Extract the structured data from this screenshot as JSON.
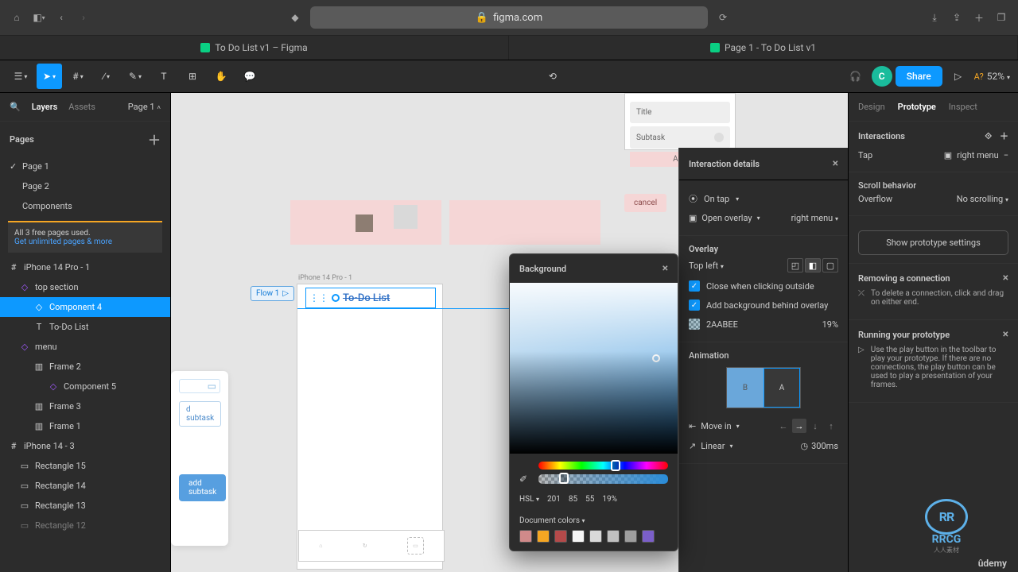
{
  "browser": {
    "url_host": "figma.com",
    "tab1": "To Do List v1 – Figma",
    "tab2": "Page 1 - To Do List v1"
  },
  "toolbar": {
    "share": "Share",
    "a2": "A?",
    "zoom": "52%",
    "avatar": "C"
  },
  "leftTabs": {
    "layers": "Layers",
    "assets": "Assets",
    "pageSel": "Page 1"
  },
  "pages": {
    "hdr": "Pages",
    "p1": "Page 1",
    "p2": "Page 2",
    "p3": "Components"
  },
  "banner": {
    "line1": "All 3 free pages used.",
    "line2": "Get unlimited pages & more"
  },
  "layers": {
    "f1": "iPhone 14 Pro - 1",
    "l1": "top section",
    "l2": "Component 4",
    "l3": "To-Do List",
    "l4": "menu",
    "l5": "Frame 2",
    "l6": "Component 5",
    "l7": "Frame 3",
    "l8": "Frame 1",
    "f2": "iPhone 14 - 3",
    "r1": "Rectangle 15",
    "r2": "Rectangle 14",
    "r3": "Rectangle 13",
    "r4": "Rectangle 12"
  },
  "canvas": {
    "frameLabel": "iPhone 14 Pro - 1",
    "flow": "Flow 1",
    "todo": "To-Do List",
    "title": "Title",
    "subtask": "Subtask",
    "add": "Add",
    "cancel": "cancel",
    "addsub1": "d subtask",
    "addsub2": "add subtask"
  },
  "bg": {
    "hdr": "Background",
    "mode": "HSL",
    "h": "201",
    "s": "85",
    "l": "55",
    "a": "19%",
    "doc": "Document colors",
    "swatches": [
      "#d08a8a",
      "#f5a623",
      "#b44a4a",
      "#f5f5f5",
      "#d9d9d9",
      "#c0c0c0",
      "#9e9e9e",
      "#7b5fc9"
    ]
  },
  "inter": {
    "hdr": "Interaction details",
    "trigger": "On tap",
    "action": "Open overlay",
    "target": "right menu",
    "overlay": "Overlay",
    "pos": "Top left",
    "chk1": "Close when clicking outside",
    "chk2": "Add background behind overlay",
    "hex": "2AABEE",
    "opacity": "19%",
    "anim": "Animation",
    "b": "B",
    "a2": "A",
    "move": "Move in",
    "ease": "Linear",
    "dur": "300ms"
  },
  "rr": {
    "design": "Design",
    "proto": "Prototype",
    "inspect": "Inspect",
    "interactions": "Interactions",
    "tap": "Tap",
    "target": "right menu",
    "scroll": "Scroll behavior",
    "overflow": "Overflow",
    "noscroll": "No scrolling",
    "showSettings": "Show prototype settings",
    "removing": "Removing a connection",
    "removingTxt": "To delete a connection, click and drag on either end.",
    "running": "Running your prototype",
    "runningTxt": "Use the play button in the toolbar to play your prototype. If there are no connections, the play button can be used to play a presentation of your frames."
  },
  "logo": {
    "rr": "RR",
    "rrcg": "RRCG",
    "sub": "人人素材",
    "udemy": "ûdemy"
  }
}
